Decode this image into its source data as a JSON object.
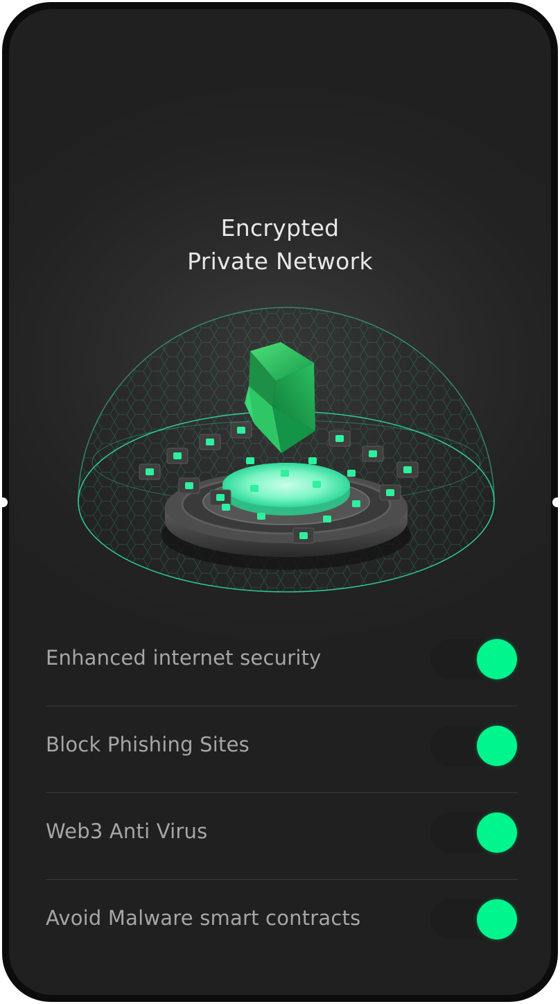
{
  "title": {
    "line1": "Encrypted",
    "line2": "Private Network"
  },
  "accent_color": "#00f58c",
  "illustration": {
    "icon": "shield-dome-network-icon"
  },
  "toggles": [
    {
      "label": "Enhanced internet security",
      "on": true
    },
    {
      "label": "Block Phishing Sites",
      "on": true
    },
    {
      "label": "Web3 Anti Virus",
      "on": true
    },
    {
      "label": "Avoid Malware smart contracts",
      "on": true
    }
  ]
}
